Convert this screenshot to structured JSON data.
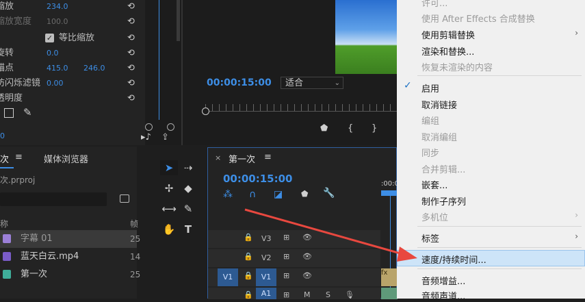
{
  "effects": {
    "rows": [
      {
        "label": "缩放",
        "value": "234.0",
        "value2": ""
      },
      {
        "label": "缩放宽度",
        "value": "100.0",
        "value2": ""
      },
      {
        "label": "等比缩放",
        "value": "",
        "value2": ""
      },
      {
        "label": "旋转",
        "value": "0.0",
        "value2": ""
      },
      {
        "label": "锚点",
        "value": "415.0",
        "value2": "246.0"
      },
      {
        "label": "防闪烁滤镜",
        "value": "0.00",
        "value2": ""
      },
      {
        "label": "透明度",
        "value": "",
        "value2": ""
      }
    ],
    "bottom_value": "0"
  },
  "monitor": {
    "timecode": "00:00:15:00",
    "fit_label": "适合"
  },
  "project": {
    "tab_name": "次",
    "tab_browser": "媒体浏览器",
    "project_file": "次.prproj",
    "col_name": "称",
    "col_rate": "帧",
    "items": [
      {
        "name": "字幕 01",
        "rate": "25",
        "color": "#9c80d8"
      },
      {
        "name": "蓝天白云.mp4",
        "rate": "14",
        "color": "#7a5cc8"
      },
      {
        "name": "第一次",
        "rate": "25",
        "color": "#3fae9a"
      }
    ]
  },
  "timeline": {
    "sequence_name": "第一次",
    "timecode": "00:00:15:00",
    "ruler_label": ":00:0",
    "tracks": [
      "V3",
      "V2",
      "V1",
      "A1"
    ],
    "source_v1": "V1",
    "clip_label": "fx",
    "mute": "M",
    "solo": "S"
  },
  "menu": {
    "items": [
      {
        "label": "许可...",
        "disabled": true,
        "submenu": false
      },
      {
        "label": "使用 After Effects 合成替换",
        "disabled": true,
        "submenu": false
      },
      {
        "label": "使用剪辑替换",
        "disabled": false,
        "submenu": true
      },
      {
        "label": "渲染和替换...",
        "disabled": false,
        "submenu": false
      },
      {
        "label": "恢复未渲染的内容",
        "disabled": true,
        "submenu": false
      },
      {
        "label": "启用",
        "disabled": false,
        "submenu": false,
        "checked": true
      },
      {
        "label": "取消链接",
        "disabled": false,
        "submenu": false
      },
      {
        "label": "编组",
        "disabled": true,
        "submenu": false
      },
      {
        "label": "取消编组",
        "disabled": true,
        "submenu": false
      },
      {
        "label": "同步",
        "disabled": true,
        "submenu": false
      },
      {
        "label": "合并剪辑...",
        "disabled": true,
        "submenu": false
      },
      {
        "label": "嵌套...",
        "disabled": false,
        "submenu": false
      },
      {
        "label": "制作子序列",
        "disabled": false,
        "submenu": false
      },
      {
        "label": "多机位",
        "disabled": true,
        "submenu": true
      },
      {
        "label": "标签",
        "disabled": false,
        "submenu": true
      },
      {
        "label": "速度/持续时间...",
        "disabled": false,
        "submenu": false,
        "highlighted": true
      },
      {
        "label": "音频增益...",
        "disabled": false,
        "submenu": false
      },
      {
        "label": "音频声道...",
        "disabled": false,
        "submenu": false
      }
    ]
  },
  "colors": {
    "accent_blue": "#3d8ee6",
    "annotation_red": "#e8483f",
    "menu_highlight": "#cde4f8"
  }
}
